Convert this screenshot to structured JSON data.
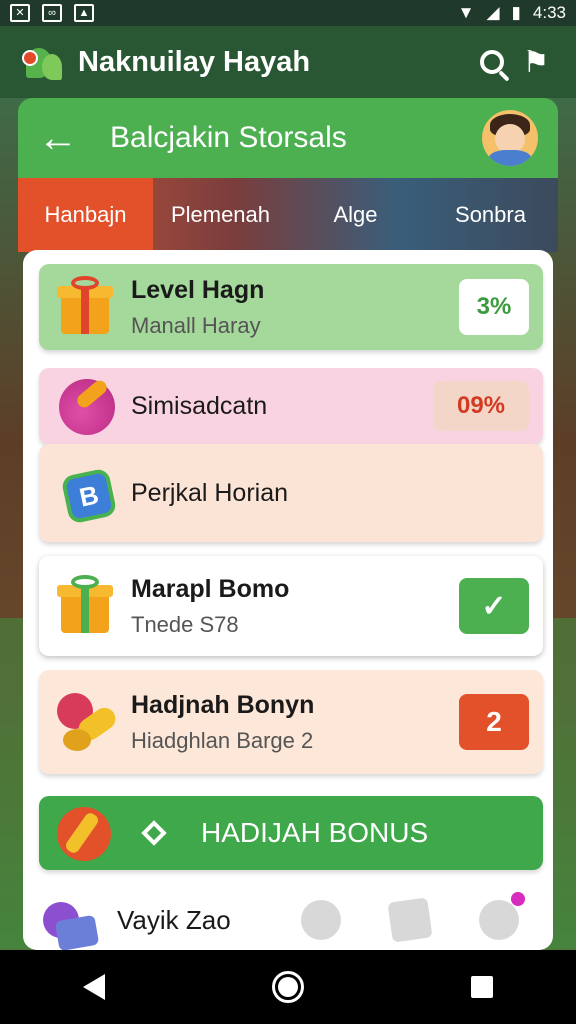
{
  "status_bar": {
    "time": "4:33",
    "left_icons": [
      "image-icon",
      "chat-icon",
      "photo-icon"
    ],
    "right_icons": [
      "wifi-icon",
      "signal-icon",
      "battery-icon"
    ]
  },
  "app_bar": {
    "title": "Naknuilay Hayah",
    "logo": "leaf-logo-icon",
    "actions": [
      "search-icon",
      "flag-icon"
    ]
  },
  "card_header": {
    "title": "Balcjakin Storsals",
    "back_icon": "back-arrow-icon",
    "avatar_icon": "child-avatar-icon"
  },
  "tabs": [
    {
      "label": "Hanbajn",
      "active": true
    },
    {
      "label": "Plemenah",
      "active": false
    },
    {
      "label": "Alge",
      "active": false
    },
    {
      "label": "Sonbra",
      "active": false
    }
  ],
  "rows": [
    {
      "title": "Level Hagn",
      "subtitle": "Manall Haray",
      "badge": "3%",
      "icon": "gift-icon",
      "badge_color": "#ffffff",
      "badge_text_color": "#3c9b3e"
    },
    {
      "title": "Simisadcatn",
      "subtitle": "",
      "badge": "09%",
      "icon": "rocket-icon",
      "badge_color": "#f4d6c9",
      "badge_text_color": "#d23b22"
    },
    {
      "title": "Perjkal Horian",
      "subtitle": "",
      "badge": "",
      "icon": "ticket-icon"
    },
    {
      "title": "Marapl Bomo",
      "subtitle": "Tnede S78",
      "badge": "✓",
      "icon": "gift-icon",
      "badge_color": "#4caf50",
      "badge_text_color": "#ffffff"
    },
    {
      "title": "Hadjnah Bonyn",
      "subtitle": "Hiadghlan Barge 2",
      "badge": "2",
      "icon": "candy-icon",
      "badge_color": "#e2512a",
      "badge_text_color": "#ffffff"
    }
  ],
  "bonus_button": {
    "label": "HADIJAH BONUS",
    "icon": "bonus-pin-icon",
    "marker_icon": "diamond-icon"
  },
  "bottom_row": {
    "label": "Vayik Zao",
    "icon": "bag-icon",
    "nav_icons": [
      "home-icon",
      "mail-icon",
      "chat-icon"
    ]
  },
  "system_nav": [
    "back-icon",
    "home-icon",
    "recents-icon"
  ]
}
